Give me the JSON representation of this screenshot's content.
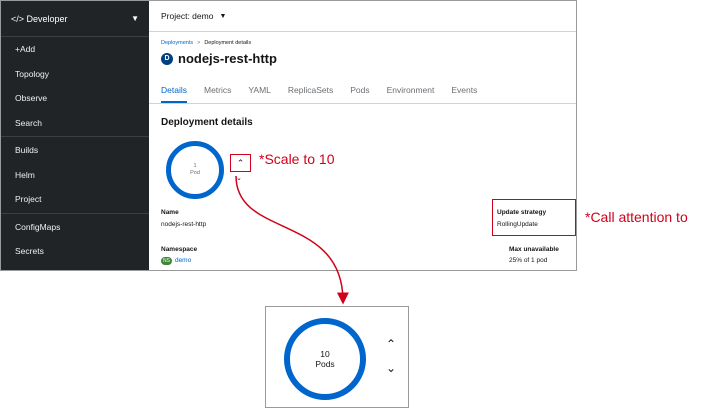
{
  "sidebar": {
    "perspective_label": "</> Developer",
    "items": [
      {
        "label": "+Add"
      },
      {
        "label": "Topology"
      },
      {
        "label": "Observe"
      },
      {
        "label": "Search"
      },
      {
        "label": "Builds"
      },
      {
        "label": "Helm"
      },
      {
        "label": "Project"
      },
      {
        "label": "ConfigMaps"
      },
      {
        "label": "Secrets"
      }
    ]
  },
  "project_bar": {
    "label": "Project: demo"
  },
  "breadcrumb": {
    "deployments": "Deployments",
    "separator": ">",
    "current": "Deployment details"
  },
  "resource": {
    "badge": "D",
    "name": "nodejs-rest-http"
  },
  "tabs": [
    {
      "label": "Details"
    },
    {
      "label": "Metrics"
    },
    {
      "label": "YAML"
    },
    {
      "label": "ReplicaSets"
    },
    {
      "label": "Pods"
    },
    {
      "label": "Environment"
    },
    {
      "label": "Events"
    }
  ],
  "details": {
    "section_title": "Deployment details",
    "pod_ring": {
      "count": "1",
      "unit": "Pod"
    },
    "name_label": "Name",
    "name_value": "nodejs-rest-http",
    "namespace_label": "Namespace",
    "namespace_badge": "NS",
    "namespace_value": "demo",
    "update_strategy_label": "Update strategy",
    "update_strategy_value": "RollingUpdate",
    "max_unavailable_label": "Max unavailable",
    "max_unavailable_value": "25% of 1 pod"
  },
  "annotations": {
    "scale": "*Scale to 10",
    "attention": "*Call attention to"
  },
  "zoom": {
    "count": "10",
    "unit": "Pods"
  },
  "colors": {
    "accent": "#0066cc",
    "annotation": "#d0021b",
    "sidebar_bg": "#212427",
    "namespace_badge": "#3e8635"
  }
}
